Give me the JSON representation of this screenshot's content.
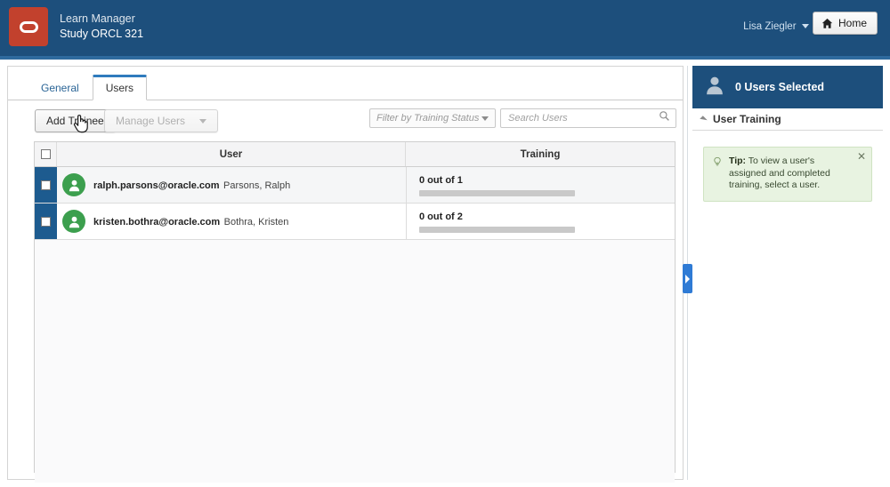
{
  "header": {
    "logo_icon": "oracle-logo-icon",
    "app_title": "Learn Manager",
    "app_subtitle": "Study ORCL 321",
    "user_name": "Lisa Ziegler",
    "user_caret_icon": "chevron-down-icon",
    "home_label": "Home",
    "home_icon": "home-icon",
    "bg_color": "#1d4f7c",
    "logo_color": "#c2412d"
  },
  "tabs": [
    {
      "label": "General",
      "active": false
    },
    {
      "label": "Users",
      "active": true
    }
  ],
  "toolbar": {
    "add_trainee_label": "Add Trainee",
    "manage_users_label": "Manage Users",
    "manage_users_caret_icon": "chevron-down-icon",
    "manage_users_disabled": true,
    "filter_placeholder": "Filter by Training Status",
    "filter_caret_icon": "chevron-down-icon",
    "search_placeholder": "Search Users",
    "search_value": "",
    "search_icon": "search-icon"
  },
  "table": {
    "select_all_checked": false,
    "columns": {
      "checkbox": "",
      "user": "User",
      "training": "Training"
    },
    "rows": [
      {
        "checked": false,
        "avatar_icon": "user-avatar-icon",
        "email": "ralph.parsons@oracle.com",
        "name": "Parsons, Ralph",
        "training_label": "0 out of 1",
        "training_completed": 0,
        "training_total": 1,
        "training_percent": 0
      },
      {
        "checked": false,
        "avatar_icon": "user-avatar-icon",
        "email": "kristen.bothra@oracle.com",
        "name": "Bothra, Kristen",
        "training_label": "0 out of 2",
        "training_completed": 0,
        "training_total": 2,
        "training_percent": 0
      }
    ]
  },
  "side_panel": {
    "header_icon": "user-silhouette-icon",
    "header_title": "0 Users Selected",
    "section_collapse_icon": "triangle-collapse-icon",
    "section_title": "User Training",
    "tip": {
      "icon": "lightbulb-icon",
      "label": "Tip:",
      "text": "To view a user's assigned and completed training, select a user.",
      "close_icon": "close-icon",
      "bg_color": "#e8f3e1"
    },
    "collapse_handle_icon": "chevron-right-icon",
    "handle_color": "#2f7bd5"
  },
  "cursor": {
    "icon": "pointing-hand-cursor"
  }
}
